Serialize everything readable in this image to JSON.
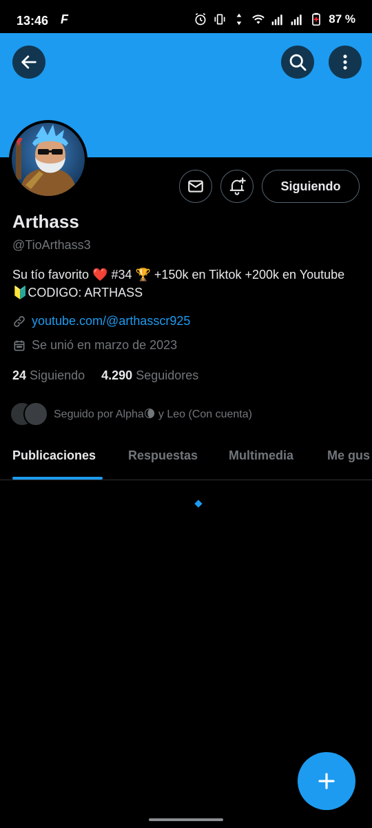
{
  "status_bar": {
    "time": "13:46",
    "app_glyph": "F",
    "battery": "87 %"
  },
  "header": {
    "back_icon": "arrow-left-icon",
    "search_icon": "search-icon",
    "more_icon": "more-vertical-icon"
  },
  "profile": {
    "name": "Arthass",
    "handle": "@TioArthass3",
    "bio": "Su tío favorito ❤️ #34 🏆 +150k en Tiktok +200k en Youtube 🔰CODIGO: ARTHASS",
    "link": "youtube.com/@arthasscr925",
    "joined": "Se unió en marzo de 2023",
    "following_count": "24",
    "following_label": "Siguiendo",
    "followers_count": "4.290",
    "followers_label": "Seguidores",
    "followed_by": "Seguido por Alpha🌘 y Leo (Con cuenta)"
  },
  "actions": {
    "follow_label": "Siguiendo"
  },
  "tabs": [
    {
      "label": "Publicaciones",
      "active": true
    },
    {
      "label": "Respuestas",
      "active": false
    },
    {
      "label": "Multimedia",
      "active": false
    },
    {
      "label": "Me gus",
      "active": false
    }
  ],
  "colors": {
    "accent": "#1d9bf0",
    "background": "#000000",
    "muted": "#71767b"
  }
}
